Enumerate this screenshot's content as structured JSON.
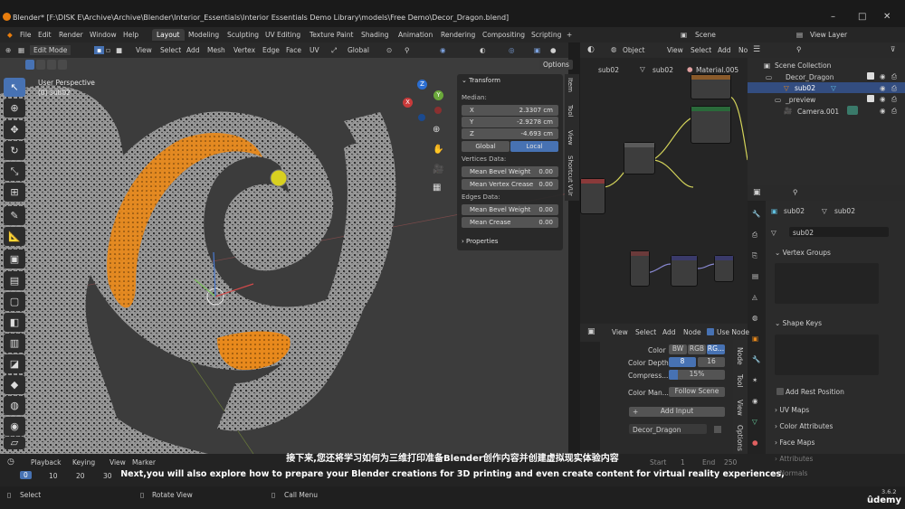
{
  "window": {
    "title": "Blender* [F:\\DISK E\\Archive\\Archive\\Blender\\Interior_Essentials\\Interior Essentials Demo Library\\models\\Free Demo\\Decor_Dragon.blend]",
    "minimize": "–",
    "maximize": "□",
    "close": "✕"
  },
  "menu": {
    "items": [
      "File",
      "Edit",
      "Render",
      "Window",
      "Help"
    ],
    "workspaces": [
      "Layout",
      "Modeling",
      "Sculpting",
      "UV Editing",
      "Texture Paint",
      "Shading",
      "Animation",
      "Rendering",
      "Compositing",
      "Scripting"
    ],
    "active_workspace": "Layout",
    "scene": "Scene",
    "view_layer": "View Layer"
  },
  "viewport_header": {
    "mode": "Edit Mode",
    "menus": [
      "View",
      "Select",
      "Add",
      "Mesh",
      "Vertex",
      "Edge",
      "Face",
      "UV"
    ],
    "transform": "Global",
    "options": "Options"
  },
  "viewport": {
    "perspective": "User Perspective",
    "object": "(0) sub02",
    "gizmo_axes": [
      "Z",
      "Y",
      "X"
    ]
  },
  "npanel": {
    "section": "Transform",
    "median": "Median:",
    "x_label": "X",
    "x_value": "2.3307 cm",
    "y_label": "Y",
    "y_value": "-2.9278 cm",
    "z_label": "Z",
    "z_value": "-4.693 cm",
    "global": "Global",
    "local": "Local",
    "vertices_data": "Vertices Data:",
    "mean_bevel_weight_v": "Mean Bevel Weight",
    "mean_bevel_weight_v_val": "0.00",
    "mean_vertex_crease": "Mean Vertex Crease",
    "mean_vertex_crease_val": "0.00",
    "edges_data": "Edges Data:",
    "mean_bevel_weight_e": "Mean Bevel Weight",
    "mean_bevel_weight_e_val": "0.00",
    "mean_crease": "Mean Crease",
    "mean_crease_val": "0.00",
    "properties": "Properties",
    "side_tabs": [
      "Item",
      "Tool",
      "View",
      "Shortcut VUr"
    ]
  },
  "node_editor": {
    "object": "Object",
    "menus": [
      "View",
      "Select",
      "Add",
      "No"
    ],
    "breadcrumb": [
      "sub02",
      "sub02",
      "Material.005"
    ]
  },
  "outliner": {
    "scene_collection": "Scene Collection",
    "items": [
      "Decor_Dragon",
      "sub02",
      "_preview",
      "Camera.001"
    ]
  },
  "properties": {
    "breadcrumb": [
      "sub02",
      "sub02"
    ],
    "mesh_name": "sub02",
    "panels": [
      "Vertex Groups",
      "Shape Keys",
      "Add Rest Position",
      "UV Maps",
      "Color Attributes",
      "Face Maps",
      "Attributes",
      "Normals"
    ]
  },
  "output_panel": {
    "menus": [
      "View",
      "Select",
      "Add",
      "Node"
    ],
    "use_nodes": "Use Node",
    "color_label": "Color",
    "bw": "BW",
    "rgb": "RGB",
    "rgba": "RG...",
    "color_depth": "Color Depth",
    "depth_8": "8",
    "depth_16": "16",
    "compress": "Compress...",
    "compress_val": "15%",
    "color_man": "Color Man...",
    "follow_scene": "Follow Scene",
    "add_input": "Add Input",
    "input_name": "Decor_Dragon",
    "side_tabs": [
      "Node",
      "Tool",
      "View",
      "Options"
    ]
  },
  "timeline": {
    "menus": [
      "Playback",
      "Keying",
      "View",
      "Marker"
    ],
    "frames": [
      "0",
      "10",
      "20",
      "30"
    ],
    "start_label": "Start",
    "start": "1",
    "end_label": "End",
    "end": "250"
  },
  "status": {
    "select": "Select",
    "rotate": "Rotate View",
    "call_menu": "Call Menu",
    "version": "3.6.2",
    "brand": "ûdemy"
  },
  "subtitles": {
    "cn": "接下来,您还将学习如何为三维打印准备Blender创作内容并创建虚拟现实体验内容",
    "en": "Next,you will also explore how to prepare your Blender creations for 3D printing and even create content for virtual reality experiences,"
  },
  "colors": {
    "accent": "#4772b3",
    "selection": "#e8891c",
    "logo": "#e87d0d"
  }
}
